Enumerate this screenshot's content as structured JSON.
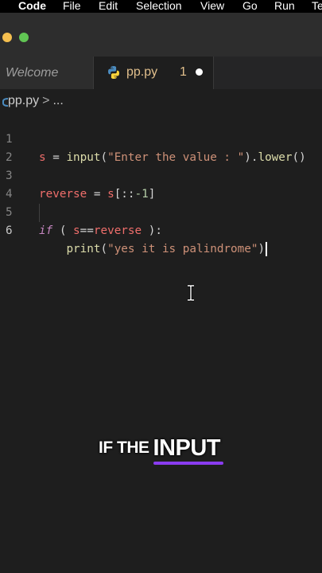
{
  "menubar": {
    "app_name": "Code",
    "items": [
      "File",
      "Edit",
      "Selection",
      "View",
      "Go",
      "Run",
      "Te"
    ]
  },
  "tabs": {
    "welcome_label": "Welcome",
    "active_label": "pp.py",
    "active_badge": "1"
  },
  "breadcrumb": {
    "file": "pp.py",
    "separator": ">",
    "more": "..."
  },
  "editor": {
    "lines": [
      {
        "number": "1",
        "text": "s = input(\"Enter the value : \").lower()"
      },
      {
        "number": "2",
        "text": ""
      },
      {
        "number": "3",
        "text": "reverse = s[::-1]"
      },
      {
        "number": "4",
        "text": ""
      },
      {
        "number": "5",
        "text": "if ( s==reverse ):"
      },
      {
        "number": "6",
        "text": "    print(\"yes it is palindrome\")"
      }
    ],
    "active_line": "6"
  },
  "caption": {
    "small": "IF THE",
    "big": "INPUT"
  },
  "colors": {
    "background": "#1e1e1e",
    "modified_tab": "#e2c08d",
    "caption_underline": "#8a3cf0"
  },
  "icons": [
    "python-file-icon",
    "unsaved-dot-icon",
    "text-cursor-icon"
  ]
}
